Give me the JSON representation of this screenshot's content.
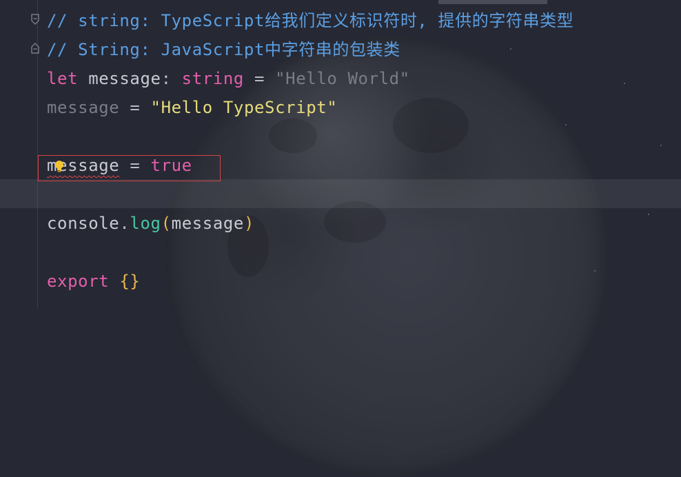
{
  "editor": {
    "lines": [
      {
        "id": "line-comment-1",
        "text": "// string: TypeScript给我们定义标识符时, 提供的字符串类型"
      },
      {
        "id": "line-comment-2",
        "text": "// String: JavaScript中字符串的包装类"
      },
      {
        "tokens": [
          "let",
          " message",
          ": ",
          "string",
          " = ",
          "\"Hello World\""
        ]
      },
      {
        "tokens": [
          "message",
          " = ",
          "\"Hello TypeScript\""
        ]
      },
      {
        "tokens": [
          "message",
          " = ",
          "true"
        ]
      },
      {
        "tokens": [
          "console",
          ".",
          "log",
          "(",
          "message",
          ")"
        ]
      },
      {
        "tokens": [
          "export",
          " ",
          "{}"
        ]
      }
    ]
  },
  "icons": {
    "fold": "fold-marker-icon",
    "hint": "lightbulb-icon"
  },
  "colors": {
    "background": "#262834",
    "comment": "#5b9fe2",
    "keyword": "#e35faa",
    "string": "#e6dc7c",
    "function": "#49c6a2",
    "error": "#d24545"
  }
}
